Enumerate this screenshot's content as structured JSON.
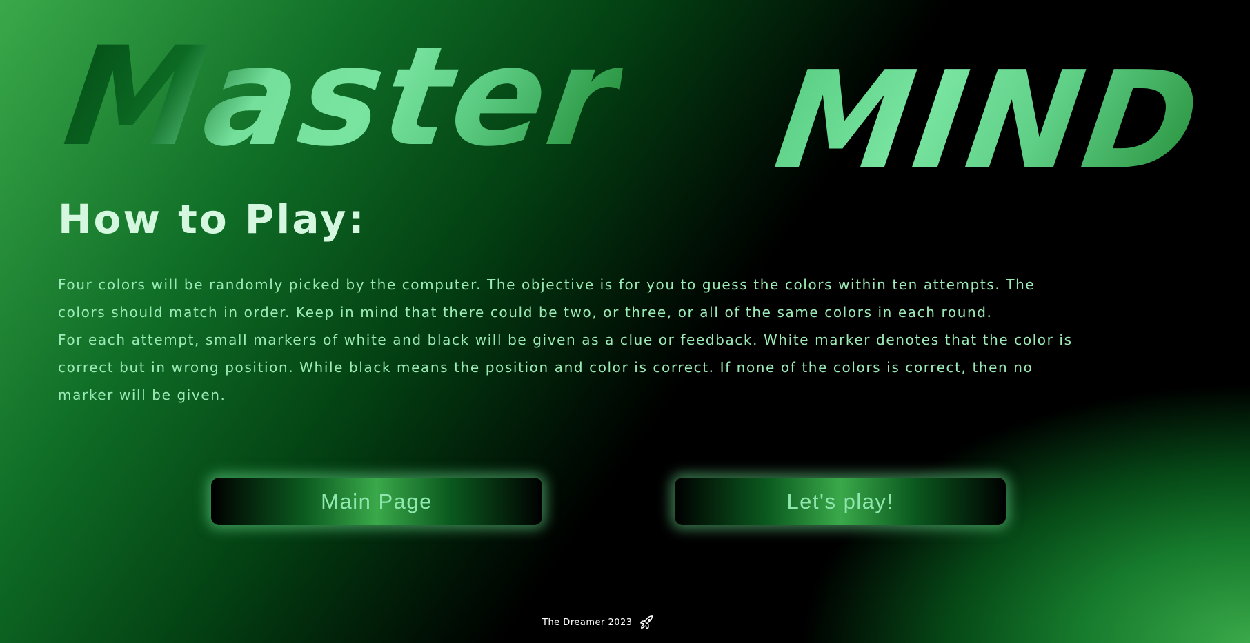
{
  "header": {
    "title_part1": "Master",
    "title_part2": "MIND"
  },
  "how_to_play": {
    "heading": "How to Play:",
    "paragraphs": [
      "Four colors will be randomly picked by the computer. The objective is for you to guess the colors within ten attempts. The colors should match in order. Keep in mind that there could be two, or three, or all of the same colors in each round.",
      "For each attempt, small markers of white and black will be given as a clue or feedback. White marker denotes that the color is correct but in wrong position. While black means the position and color is correct. If none of the colors is correct, then no marker will be given."
    ]
  },
  "buttons": {
    "main_page": "Main Page",
    "play": "Let's play!"
  },
  "footer": {
    "credit": "The Dreamer 2023",
    "icon": "rocket-icon"
  },
  "colors": {
    "accent": "#3aa94a",
    "title_light": "#79e4a0",
    "text": "#9ceab6",
    "heading": "#d5f7df"
  }
}
